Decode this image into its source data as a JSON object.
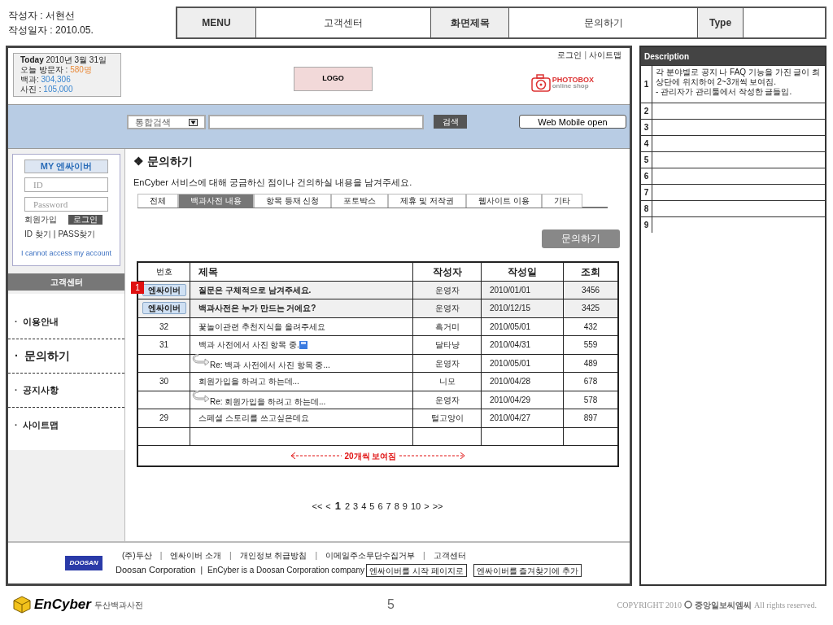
{
  "meta": {
    "author": "작성자 : 서현선",
    "date": "작성일자 : 2010.05."
  },
  "header": [
    {
      "text": "MENU",
      "kind": "label"
    },
    {
      "text": "고객센터",
      "kind": "value"
    },
    {
      "text": "화면제목",
      "kind": "label"
    },
    {
      "text": "문의하기",
      "kind": "value"
    },
    {
      "text": "Type",
      "kind": "label"
    }
  ],
  "page": {
    "stats": {
      "today_label": "Today",
      "today": "2010년 3월 31일",
      "visitors_label": "오늘 방문자 :",
      "visitors": "580명",
      "baekgwa_label": "백과:",
      "baekgwa": "304,306",
      "photo_label": "사진 :",
      "photo": "105,000"
    },
    "logo": "LOGO",
    "util_links": [
      {
        "text": "로그인",
        "kind": "link"
      },
      {
        "text": "|",
        "kind": "separator"
      },
      {
        "text": "사이트맵",
        "kind": "link"
      }
    ],
    "photobox": {
      "name": "PHOTOBOX",
      "sub": "online shop"
    },
    "search": {
      "scope": "통합검색",
      "button": "검색",
      "mobile": "Web Mobile open"
    },
    "login": {
      "title": "MY 엔싸이버",
      "id_placeholder": "ID",
      "pw_placeholder": "Password",
      "join": "회원가입",
      "login_button": "로그인",
      "find_id": "ID 찾기",
      "find_sep": "|",
      "find_pw": "PASS찾기",
      "help": "I cannot access my account"
    },
    "sidebar": {
      "title": "고객센터",
      "items": [
        {
          "label": "·  이용안내",
          "selected": false
        },
        {
          "label": "·  문의하기",
          "selected": true
        },
        {
          "label": "·  공지사항",
          "selected": false
        },
        {
          "label": "·  사이트맵",
          "selected": false
        }
      ]
    },
    "content": {
      "title": "❖ 문의하기",
      "intro": "EnCyber 서비스에 대해 궁금하신 점이나 건의하실 내용을 남겨주세요.",
      "tabs": [
        {
          "label": "전체",
          "selected": false
        },
        {
          "label": "백과사전 내용",
          "selected": true
        },
        {
          "label": "항목 등재 신청",
          "selected": false
        },
        {
          "label": "포토박스",
          "selected": false
        },
        {
          "label": "제휴 및 저작권",
          "selected": false
        },
        {
          "label": "웹사이트 이용",
          "selected": false
        },
        {
          "label": "기타",
          "selected": false
        }
      ],
      "ask_button": "문의하기",
      "table": {
        "columns": [
          "번호",
          "제목",
          "작성자",
          "작성일",
          "조회"
        ],
        "rows": [
          {
            "kind": "notice",
            "badge": "엔싸이버",
            "marker": "1",
            "title": "질문은 구체적으로 남겨주세요.",
            "author": "운영자",
            "date": "2010/01/01",
            "views": "3456"
          },
          {
            "kind": "notice",
            "badge": "엔싸이버",
            "title": "백과사전은 누가 만드는 거에요?",
            "author": "운영자",
            "date": "2010/12/15",
            "views": "3425"
          },
          {
            "kind": "post",
            "no": "32",
            "title": "꽃놀이관련 추천지식을 올려주세요",
            "author": "흑거미",
            "date": "2010/05/01",
            "views": "432"
          },
          {
            "kind": "post",
            "no": "31",
            "title": "백과 사전에서 사진 항목 중.",
            "attachment": true,
            "author": "달타냥",
            "date": "2010/04/31",
            "views": "559"
          },
          {
            "kind": "reply",
            "title": "Re: 백과 사전에서 사진 항목 중...",
            "author": "운영자",
            "date": "2010/05/01",
            "views": "489"
          },
          {
            "kind": "post",
            "no": "30",
            "title": "회원가입을 하려고 하는데...",
            "author": "니모",
            "date": "2010/04/28",
            "views": "678"
          },
          {
            "kind": "reply",
            "title": "Re: 회원가입을 하려고 하는데...",
            "author": "운영자",
            "date": "2010/04/29",
            "views": "578"
          },
          {
            "kind": "post",
            "no": "29",
            "title": " 스페셜 스토리를 쓰고싶은데요",
            "author": "털고양이",
            "date": "2010/04/27",
            "views": "897"
          },
          {
            "kind": "empty"
          }
        ],
        "note": "20개씩 보여짐"
      },
      "pagination": [
        {
          "label": "<<",
          "selected": false
        },
        {
          "label": "<",
          "selected": false
        },
        {
          "label": "1",
          "selected": true
        },
        {
          "label": "2",
          "selected": false
        },
        {
          "label": "3",
          "selected": false
        },
        {
          "label": "4",
          "selected": false
        },
        {
          "label": "5",
          "selected": false
        },
        {
          "label": "6",
          "selected": false
        },
        {
          "label": "7",
          "selected": false
        },
        {
          "label": "8",
          "selected": false
        },
        {
          "label": "9",
          "selected": false
        },
        {
          "label": "10",
          "selected": false
        },
        {
          "label": ">",
          "selected": false
        },
        {
          "label": ">>",
          "selected": false
        }
      ]
    },
    "footer": {
      "doosan": "DOOSAN",
      "links": [
        {
          "text": "(주)두산",
          "kind": "link"
        },
        {
          "text": "|",
          "kind": "separator"
        },
        {
          "text": "엔싸이버 소개",
          "kind": "link"
        },
        {
          "text": "|",
          "kind": "separator"
        },
        {
          "text": "개인정보 취급방침",
          "kind": "link"
        },
        {
          "text": "|",
          "kind": "separator"
        },
        {
          "text": "이메일주소무단수집거부",
          "kind": "link"
        },
        {
          "text": "|",
          "kind": "separator"
        },
        {
          "text": "고객센터",
          "kind": "link"
        }
      ],
      "company": "Doosan Corporation",
      "company_sep": "|",
      "tagline": "EnCyber is a Doosan Corporation company",
      "buttons": [
        "엔싸이버를 시작 페이지로",
        "엔싸이버를 즐겨찾기에 추가"
      ]
    }
  },
  "description": {
    "title": "Description",
    "rows": [
      {
        "no": "1",
        "lines": [
          "각 분야별로 공지 나 FAQ 기능을 가진 글이 최상단에 위치하여 2~3개씩 보여짐.",
          "- 관리자가 관리툴에서 작성한 글들임."
        ]
      },
      {
        "no": "2"
      },
      {
        "no": "3"
      },
      {
        "no": "4"
      },
      {
        "no": "5"
      },
      {
        "no": "6"
      },
      {
        "no": "7"
      },
      {
        "no": "8"
      },
      {
        "no": "9"
      }
    ]
  },
  "slide": {
    "brand": "EnCyber",
    "brand_sub": "두산백과사전",
    "page": "5",
    "copyright": "COPYRIGHT 2010",
    "copyright_owner": "중앙일보씨엠씨",
    "copyright_tail": "All rights reserved."
  }
}
